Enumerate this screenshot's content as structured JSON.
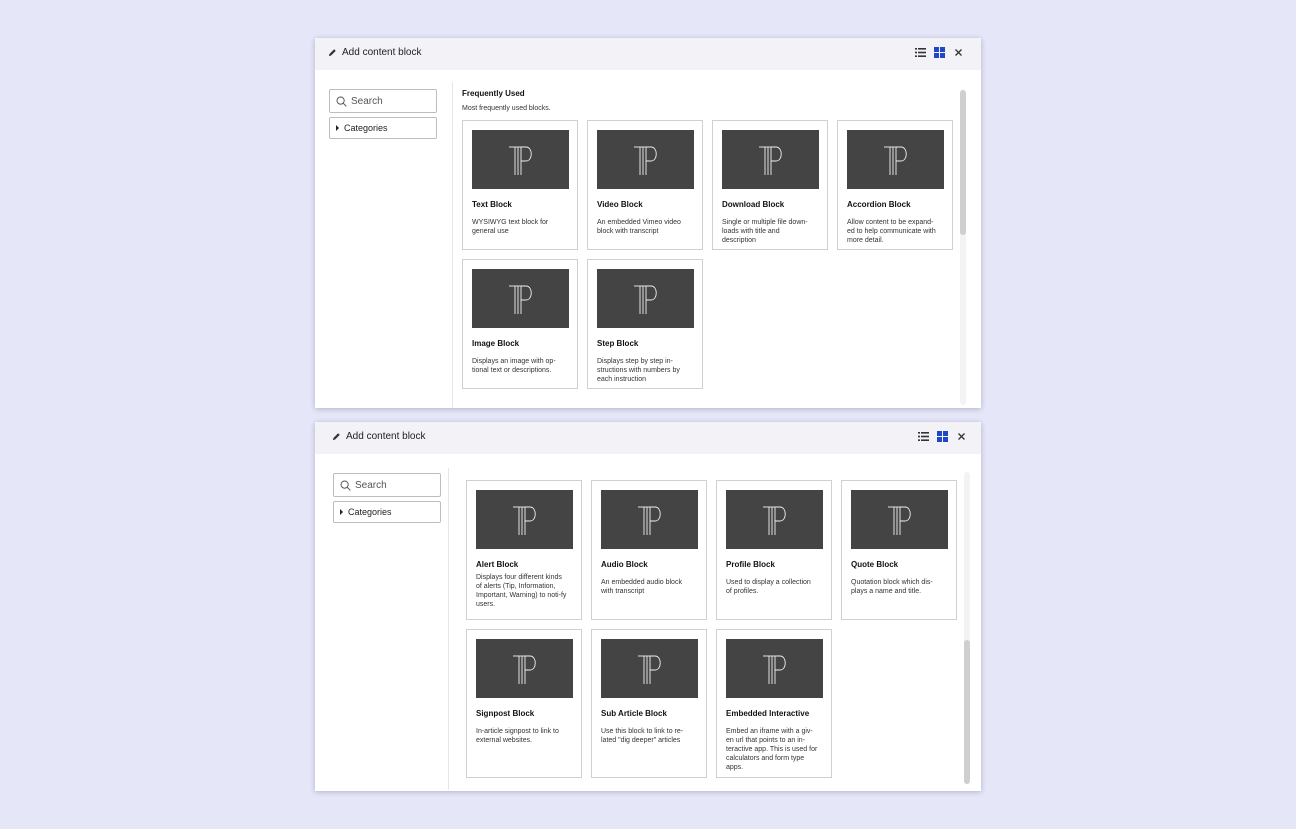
{
  "dialog": {
    "title": "Add content block",
    "search_placeholder": "Search",
    "categories_label": "Categories"
  },
  "section": {
    "title": "Frequently Used",
    "description": "Most frequently used blocks."
  },
  "colors": {
    "background": "#e5e6f8",
    "titlebar": "#f2f2f7",
    "grid_view_active": "#2346c6",
    "thumbnail": "#444444"
  },
  "icons": {
    "title": "pencil-icon",
    "list_view": "list-view-icon",
    "grid_view": "grid-view-icon",
    "close": "close-icon",
    "search": "search-icon",
    "thumbnail": "tp-logo-icon"
  },
  "view_mode": "grid",
  "scroll": {
    "panel1_position": 0.0,
    "panel2_position": 1.0
  },
  "blocks_top": [
    {
      "title": "Text Block",
      "description": "WYSIWYG text block for general use"
    },
    {
      "title": "Video Block",
      "description": "An embedded Vimeo video block with transcript"
    },
    {
      "title": "Download Block",
      "description": "Single or multiple file down-loads with title and description"
    },
    {
      "title": "Accordion Block",
      "description": "Allow content to be expand-ed to help communicate with more detail."
    },
    {
      "title": "Image Block",
      "description": "Displays an image with op-tional text or descriptions."
    },
    {
      "title": "Step Block",
      "description": "Displays step by step in-structions with numbers by each instruction"
    }
  ],
  "blocks_bottom": [
    {
      "title": "Alert Block",
      "description": "Displays four different kinds of alerts (Tip, Information, Important, Warning) to noti-fy users."
    },
    {
      "title": "Audio Block",
      "description": "An embedded audio block with transcript"
    },
    {
      "title": "Profile Block",
      "description": "Used to display a collection of profiles."
    },
    {
      "title": "Quote Block",
      "description": "Quotation block which dis-plays a name and title."
    },
    {
      "title": "Signpost Block",
      "description": "In-article signpost to link to external websites."
    },
    {
      "title": "Sub Article Block",
      "description": "Use this block to link to re-lated \"dig deeper\" articles"
    },
    {
      "title": "Embedded Interactive",
      "description": "Embed an iframe with a giv-en url that points to an in-teractive app. This is used for calculators and form type apps."
    }
  ]
}
